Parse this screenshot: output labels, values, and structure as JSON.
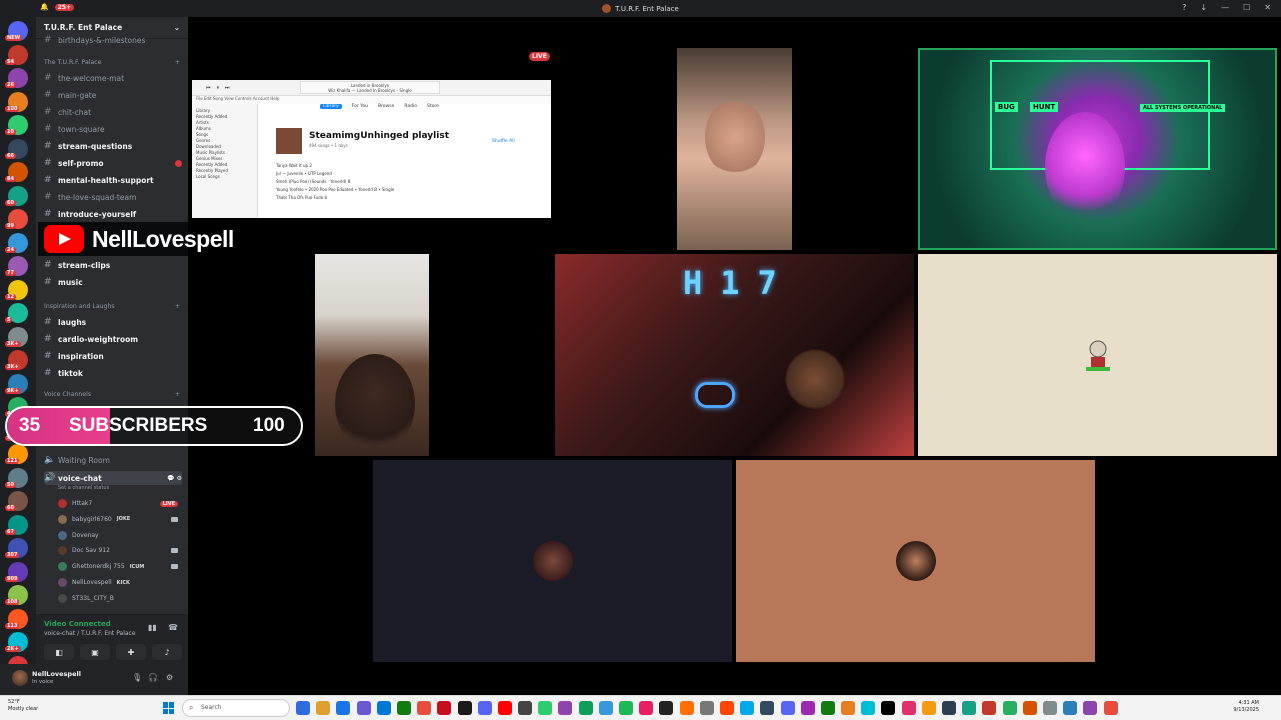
{
  "window": {
    "title": "T.U.R.F. Ent Palace",
    "notif_count": "25+",
    "controls": [
      "?",
      "↓",
      "—",
      "☐",
      "✕"
    ]
  },
  "rail": {
    "badges": [
      "NEW",
      "54",
      "26",
      "100",
      "10",
      "66",
      "84",
      "60",
      "99",
      "24",
      "77",
      "12",
      "5",
      "3K+",
      "3K+",
      "9K+",
      "4K+",
      "99",
      "121",
      "50",
      "60",
      "67",
      "307",
      "909",
      "108",
      "113",
      "2K+",
      "NEW"
    ]
  },
  "sidebar": {
    "server_name": "T.U.R.F. Ent Palace",
    "top_clipped": "birthdays-&-milestones",
    "category_1": "The T.U.R.F. Palace",
    "channels_1": [
      {
        "name": "the-welcome-mat",
        "bold": false
      },
      {
        "name": "main-gate",
        "bold": false
      },
      {
        "name": "chit-chat",
        "bold": false
      },
      {
        "name": "town-square",
        "bold": false
      },
      {
        "name": "stream-questions",
        "bold": true
      },
      {
        "name": "self-promo",
        "bold": true,
        "mention": true
      },
      {
        "name": "mental-health-support",
        "bold": true
      },
      {
        "name": "the-love-squad-team",
        "bold": false
      },
      {
        "name": "introduce-yourself",
        "bold": true
      }
    ],
    "channels_2": [
      {
        "name": "stream-clips",
        "bold": true
      },
      {
        "name": "music",
        "bold": true
      }
    ],
    "category_2": "Inspiration and Laughs",
    "channels_3": [
      {
        "name": "laughs",
        "bold": true
      },
      {
        "name": "cardio-weightroom",
        "bold": true
      },
      {
        "name": "inspiration",
        "bold": true
      },
      {
        "name": "tiktok",
        "bold": true
      }
    ],
    "category_3": "Voice Channels",
    "waiting_room": "Waiting Room",
    "voice_chat": "voice-chat",
    "voice_chat_status": "Set a channel status",
    "voice_users": [
      {
        "name": "Httak7",
        "tag": "",
        "live": true
      },
      {
        "name": "babygirl6760",
        "tag": "JOKE",
        "live": false
      },
      {
        "name": "Dovenay",
        "tag": "",
        "live": false
      },
      {
        "name": "Doc Sav 912",
        "tag": "",
        "live": false
      },
      {
        "name": "Ghettonerdkj 755",
        "tag": "ICUM",
        "live": false
      },
      {
        "name": "NellLovespell",
        "tag": "KICK",
        "live": false
      },
      {
        "name": "ST33L_CITY_B",
        "tag": "",
        "live": false
      }
    ],
    "live_label": "LIVE"
  },
  "voice_panel": {
    "status": "Video Connected",
    "channel": "voice-chat / T.U.R.F. Ent Palace"
  },
  "user_panel": {
    "name": "NellLovespell",
    "status": "In voice"
  },
  "overlays": {
    "channel_name": "NellLovespell",
    "sub_current": "35",
    "sub_label": "SUBSCRIBERS",
    "sub_goal": "100",
    "sub_progress": 0.35
  },
  "stage": {
    "live_label": "LIVE"
  },
  "screen_share": {
    "now_playing_title": "Landed in Brooklyn",
    "now_playing_sub": "Wiz Khalifa — Landed In Brooklyn - Single",
    "menu": "File  Edit  Song  View  Controls  Account  Help",
    "sidebar_items": [
      "Library",
      "Recently Added",
      "Artists",
      "Albums",
      "Songs",
      "Genres",
      "Downloaded",
      "Music Playlists",
      "Genius Mixes",
      "Recently Added",
      "Recently Played",
      "Local Songs"
    ],
    "tabs": [
      "Library",
      "For You",
      "Browse",
      "Radio",
      "Store"
    ],
    "active_tab": "Library",
    "playlist_title": "SteamimgUnhinged playlist",
    "playlist_meta": "494 songs • 1 days",
    "shuffle_label": "Shuffle All",
    "rows": [
      "Tanya Wait It up 2",
      "Jul — Juvenile • UTP Legend",
      "Smeh (Pluo Poo) (Sounds - Yonerld) B",
      "Young Yonfelo • 2020 Poo Poo Eduated • Yonerld B • Single",
      "Thats Tha Ofs Puo Fudo b"
    ]
  },
  "tiles": {
    "neon_labels": [
      "BUG",
      "HUNT",
      "ALL SYSTEMS OPERATIONAL"
    ],
    "h17_text": "H17"
  },
  "taskbar": {
    "weather_temp": "52°F",
    "weather_desc": "Mostly clear",
    "search_placeholder": "Search",
    "time": "4:31 AM",
    "date": "9/13/2025",
    "app_colors": [
      "#2d6cdf",
      "#e0a030",
      "#1a73e8",
      "#6a5acd",
      "#0078d4",
      "#107c10",
      "#e74c3c",
      "#c50f1f",
      "#1a1a1a",
      "#5865f2",
      "#ff0000",
      "#444",
      "#2ecc71",
      "#8e44ad",
      "#0f9d58",
      "#3498db",
      "#1db954",
      "#e91e63",
      "#222",
      "#ff6f00",
      "#777",
      "#ff4500",
      "#00a8e8",
      "#34495e",
      "#5865f2",
      "#9c27b0",
      "#107c10",
      "#e67e22",
      "#00bcd4",
      "#000",
      "#e1306c",
      "#f39c12",
      "#2c3e50",
      "#16a085",
      "#c0392b",
      "#27ae60",
      "#d35400",
      "#7f8c8d",
      "#2980b9",
      "#8e44ad",
      "#e74c3c"
    ]
  }
}
